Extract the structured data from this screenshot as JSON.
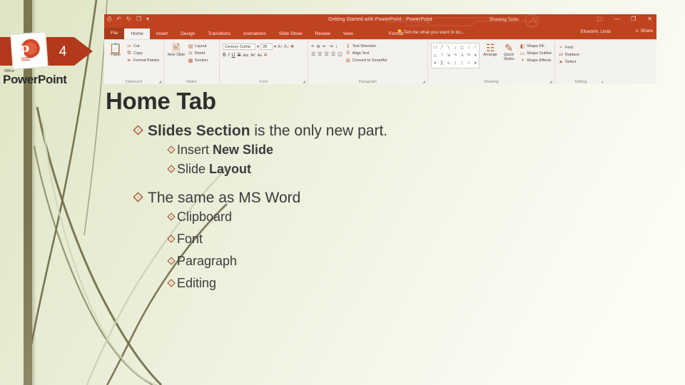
{
  "slide": {
    "number": "4",
    "title": "Home Tab",
    "logo": {
      "office_label": "Office",
      "product_label": "PowerPoint",
      "trademark": "®"
    },
    "colors": {
      "accent_red": "#b2391b",
      "ribbon_red": "#c0431f",
      "olive_band": "#7d7750",
      "title_text": "#2f2f2f",
      "body_text": "#3b3b3b",
      "bullet_outline": "#9c4a24",
      "background_light": "#fdfdf6",
      "background_green": "#dfe5c3"
    },
    "bullets": [
      {
        "level": 1,
        "bullet_icon": "diamond-bullet-icon",
        "parts": [
          {
            "text": "Slides Section",
            "bold": true
          },
          {
            "text": " is the only new part.",
            "bold": false
          }
        ]
      },
      {
        "level": 2,
        "bullet_icon": "diamond-bullet-icon",
        "parts": [
          {
            "text": "Insert ",
            "bold": false
          },
          {
            "text": "New Slide",
            "bold": true
          }
        ]
      },
      {
        "level": 2,
        "bullet_icon": "diamond-bullet-icon",
        "parts": [
          {
            "text": "Slide ",
            "bold": false
          },
          {
            "text": "Layout",
            "bold": true
          }
        ]
      },
      {
        "level": 1,
        "bullet_icon": "diamond-bullet-icon",
        "parts": [
          {
            "text": "The same as MS Word",
            "bold": false
          }
        ]
      },
      {
        "level": 2,
        "bullet_icon": "diamond-bullet-icon",
        "parts": [
          {
            "text": "Clipboard",
            "bold": false
          }
        ]
      },
      {
        "level": 2,
        "bullet_icon": "diamond-bullet-icon",
        "parts": [
          {
            "text": "Font",
            "bold": false
          }
        ]
      },
      {
        "level": 2,
        "bullet_icon": "diamond-bullet-icon",
        "parts": [
          {
            "text": "Paragraph",
            "bold": false
          }
        ]
      },
      {
        "level": 2,
        "bullet_icon": "diamond-bullet-icon",
        "parts": [
          {
            "text": "Editing",
            "bold": false
          }
        ]
      }
    ]
  },
  "ribbon": {
    "title": "Getting Started with PowerPoint - PowerPoint",
    "contextual_tools": "Drawing Tools",
    "quick_access": [
      {
        "name": "save-icon",
        "glyph": "⎙"
      },
      {
        "name": "undo-icon",
        "glyph": "↶"
      },
      {
        "name": "redo-icon",
        "glyph": "↻"
      },
      {
        "name": "start-presentation-icon",
        "glyph": "❐"
      },
      {
        "name": "customize-qat-icon",
        "glyph": "▾"
      }
    ],
    "window_buttons": [
      {
        "name": "ribbon-display-options-icon",
        "glyph": "⬚"
      },
      {
        "name": "minimize-icon",
        "glyph": "—"
      },
      {
        "name": "restore-icon",
        "glyph": "❐"
      },
      {
        "name": "close-icon",
        "glyph": "✕"
      }
    ],
    "tabs": [
      {
        "label": "File",
        "state": "file"
      },
      {
        "label": "Home",
        "state": "active"
      },
      {
        "label": "Insert",
        "state": "normal"
      },
      {
        "label": "Design",
        "state": "normal"
      },
      {
        "label": "Transitions",
        "state": "normal"
      },
      {
        "label": "Animations",
        "state": "normal"
      },
      {
        "label": "Slide Show",
        "state": "normal"
      },
      {
        "label": "Review",
        "state": "normal"
      },
      {
        "label": "View",
        "state": "normal"
      },
      {
        "label": "Format",
        "state": "contextual"
      }
    ],
    "tell_me": "Tell me what you want to do...",
    "tell_me_icon": "lightbulb-icon",
    "user_name": "Ellsworth, Linda",
    "share_label": "Share",
    "share_icon": "person-share-icon",
    "groups": {
      "clipboard": {
        "label": "Clipboard",
        "paste": "Paste",
        "paste_icon": "clipboard-icon",
        "items": [
          {
            "label": "Cut",
            "icon": "scissors-icon",
            "glyph": "✂"
          },
          {
            "label": "Copy",
            "icon": "copy-icon",
            "glyph": "⧉"
          },
          {
            "label": "Format Painter",
            "icon": "format-painter-icon",
            "glyph": "✒"
          }
        ]
      },
      "slides": {
        "label": "Slides",
        "new_slide": "New Slide",
        "new_slide_icon": "new-slide-icon",
        "items": [
          {
            "label": "Layout",
            "icon": "layout-icon",
            "glyph": "▤"
          },
          {
            "label": "Reset",
            "icon": "reset-icon",
            "glyph": "⟳"
          },
          {
            "label": "Section",
            "icon": "section-icon",
            "glyph": "▦"
          }
        ]
      },
      "font": {
        "label": "Font",
        "font_name": "Century Gothic",
        "font_size": "28",
        "grow_icon": "grow-font-icon",
        "shrink_icon": "shrink-font-icon",
        "clear_format_icon": "clear-formatting-icon",
        "buttons": [
          "B",
          "I",
          "U",
          "S",
          "abc",
          "AV",
          "Aa",
          "A"
        ]
      },
      "paragraph": {
        "label": "Paragraph",
        "items": [
          {
            "label": "Text Direction",
            "icon": "text-direction-icon",
            "glyph": "↧"
          },
          {
            "label": "Align Text",
            "icon": "align-text-icon",
            "glyph": "⌸"
          },
          {
            "label": "Convert to SmartArt",
            "icon": "smartart-icon",
            "glyph": "⊞"
          }
        ]
      },
      "drawing": {
        "label": "Drawing",
        "arrange": "Arrange",
        "arrange_icon": "arrange-icon",
        "quick_styles": "Quick Styles",
        "quick_styles_icon": "quick-styles-icon",
        "items": [
          {
            "label": "Shape Fill",
            "icon": "shape-fill-icon",
            "glyph": "◧"
          },
          {
            "label": "Shape Outline",
            "icon": "shape-outline-icon",
            "glyph": "▭"
          },
          {
            "label": "Shape Effects",
            "icon": "shape-effects-icon",
            "glyph": "◑"
          }
        ]
      },
      "editing": {
        "label": "Editing",
        "items": [
          {
            "label": "Find",
            "icon": "search-icon",
            "glyph": "⌕"
          },
          {
            "label": "Replace",
            "icon": "replace-icon",
            "glyph": "⇄"
          },
          {
            "label": "Select",
            "icon": "select-icon",
            "glyph": "➤"
          }
        ]
      }
    }
  }
}
